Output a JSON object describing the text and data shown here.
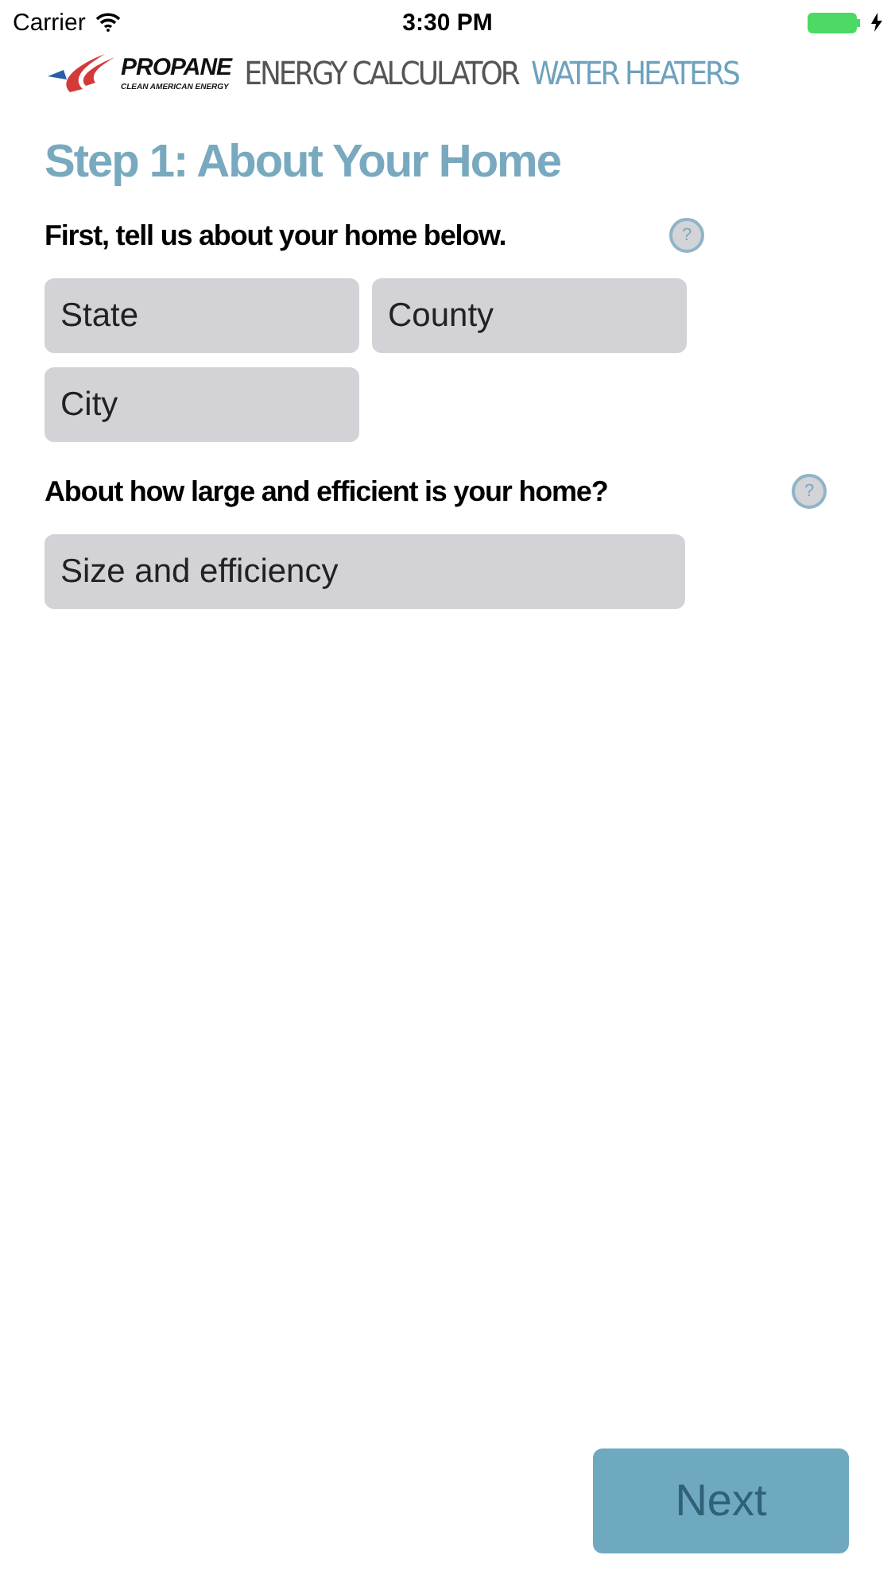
{
  "status_bar": {
    "carrier": "Carrier",
    "time": "3:30 PM",
    "battery_charging": true
  },
  "header": {
    "logo_name": "PROPANE",
    "logo_tagline": "CLEAN AMERICAN ENERGY",
    "title": "ENERGY CALCULATOR",
    "subtitle": "WATER HEATERS"
  },
  "step_title": "Step 1: About Your Home",
  "sections": [
    {
      "question": "First, tell us about your home below.",
      "help": "?",
      "fields": [
        {
          "placeholder": "State"
        },
        {
          "placeholder": "County"
        },
        {
          "placeholder": "City"
        }
      ],
      "wide": false
    },
    {
      "question": "About how large and efficient is your home?",
      "help": "?",
      "fields": [
        {
          "placeholder": "Size and efficiency"
        }
      ],
      "wide": true
    }
  ],
  "next_button": {
    "label": "Next",
    "disabled": true
  }
}
